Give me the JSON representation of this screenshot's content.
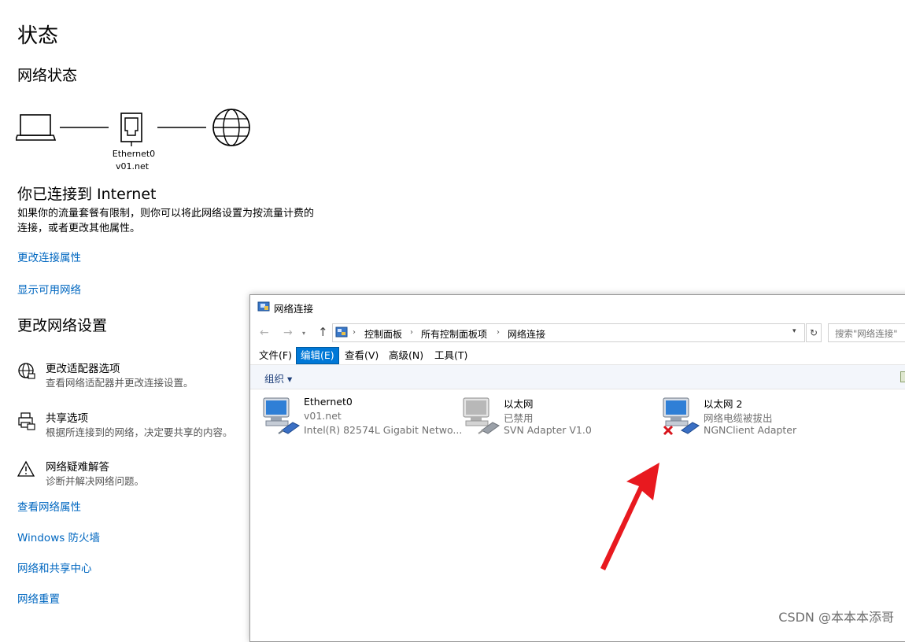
{
  "settings": {
    "title": "状态",
    "network_status_heading": "网络状态",
    "diagram": {
      "adapter_name": "Ethernet0",
      "network_name": "v01.net"
    },
    "connected_heading": "你已连接到 Internet",
    "connected_desc_line1": "如果你的流量套餐有限制，则你可以将此网络设置为按流量计费的",
    "connected_desc_line2": "连接，或者更改其他属性。",
    "link_change_properties": "更改连接属性",
    "link_show_networks": "显示可用网络",
    "change_settings_heading": "更改网络设置",
    "options": [
      {
        "title": "更改适配器选项",
        "desc": "查看网络适配器并更改连接设置。",
        "icon": "adapter-globe-icon"
      },
      {
        "title": "共享选项",
        "desc": "根据所连接到的网络，决定要共享的内容。",
        "icon": "sharing-printer-icon"
      },
      {
        "title": "网络疑难解答",
        "desc": "诊断并解决网络问题。",
        "icon": "warning-icon"
      }
    ],
    "links": [
      "查看网络属性",
      "Windows 防火墙",
      "网络和共享中心",
      "网络重置"
    ]
  },
  "window": {
    "title": "网络连接",
    "breadcrumbs": [
      "控制面板",
      "所有控制面板项",
      "网络连接"
    ],
    "search_placeholder": "搜索\"网络连接\"",
    "menu": [
      "文件(F)",
      "编辑(E)",
      "查看(V)",
      "高级(N)",
      "工具(T)"
    ],
    "active_menu_index": 1,
    "organize_label": "组织 ▾",
    "adapters": [
      {
        "name": "Ethernet0",
        "status": "v01.net",
        "desc": "Intel(R) 82574L Gigabit Netwo...",
        "state": "connected"
      },
      {
        "name": "以太网",
        "status": "已禁用",
        "desc": "SVN Adapter V1.0",
        "state": "disabled"
      },
      {
        "name": "以太网 2",
        "status": "网络电缆被拔出",
        "desc": "NGNClient Adapter",
        "state": "unplugged"
      }
    ]
  },
  "annotation": {
    "arrow_color": "#e8191f"
  },
  "watermark": "CSDN @本本本添哥",
  "colors": {
    "link": "#0067c0",
    "menu_active": "#0078d7"
  }
}
